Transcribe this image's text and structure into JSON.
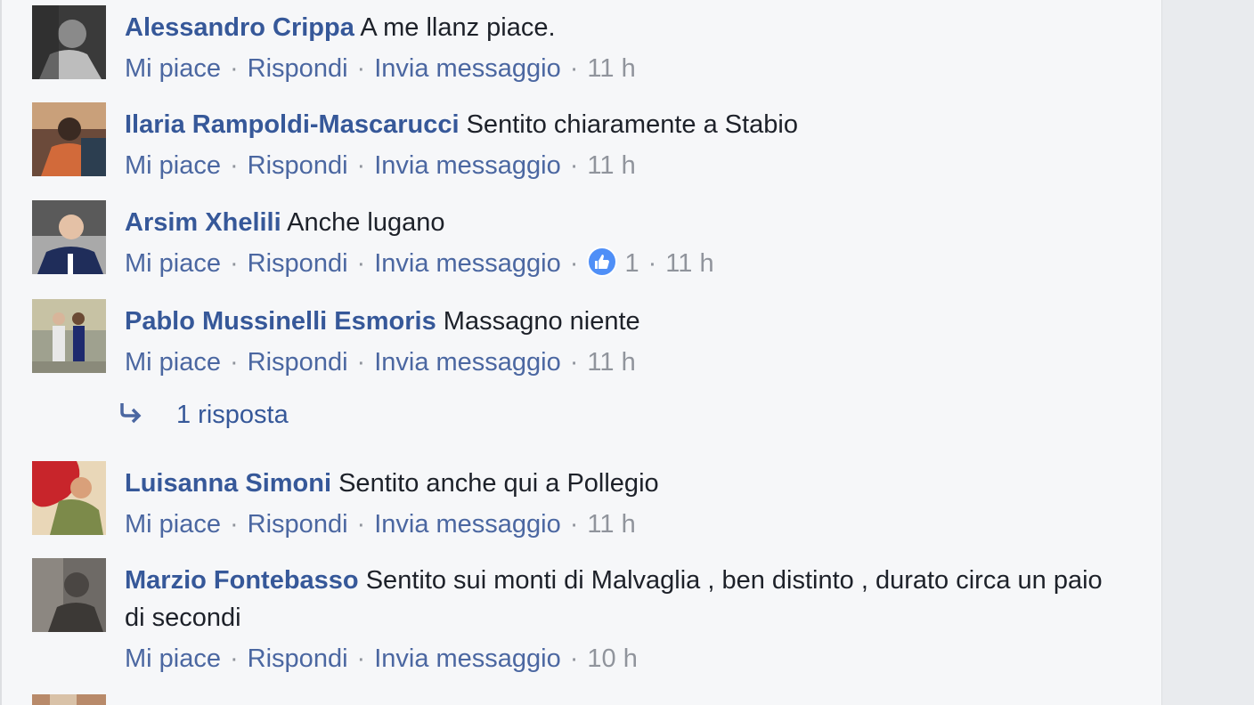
{
  "comments": [
    {
      "author": "Alessandro Crippa",
      "text": "A me llanz piace.",
      "time": "11 h",
      "likes": null
    },
    {
      "author": "Ilaria Rampoldi-Mascarucci",
      "text": "Sentito chiaramente a Stabio",
      "time": "11 h",
      "likes": null
    },
    {
      "author": "Arsim Xhelili",
      "text": "Anche lugano",
      "time": "11 h",
      "likes": "1"
    },
    {
      "author": "Pablo Mussinelli Esmoris",
      "text": "Massagno niente",
      "time": "11 h",
      "likes": null
    },
    {
      "author": "Luisanna Simoni",
      "text": "Sentito anche qui a Pollegio",
      "time": "11 h",
      "likes": null
    },
    {
      "author": "Marzio Fontebasso",
      "text": "Sentito sui monti di Malvaglia , ben distinto , durato circa un paio di secondi",
      "time": "10 h",
      "likes": null
    }
  ],
  "actions": {
    "like": "Mi piace",
    "reply": "Rispondi",
    "message": "Invia messaggio",
    "separator": "·"
  },
  "replies_link": "1 risposta",
  "colors": {
    "author": "#365899",
    "link": "#4b67a1",
    "meta": "#90949c",
    "like_badge": "#4f8ff7",
    "background": "#f6f7f9"
  },
  "icons": {
    "reply_arrow": "reply-arrow-icon",
    "like": "thumbs-up-icon"
  }
}
